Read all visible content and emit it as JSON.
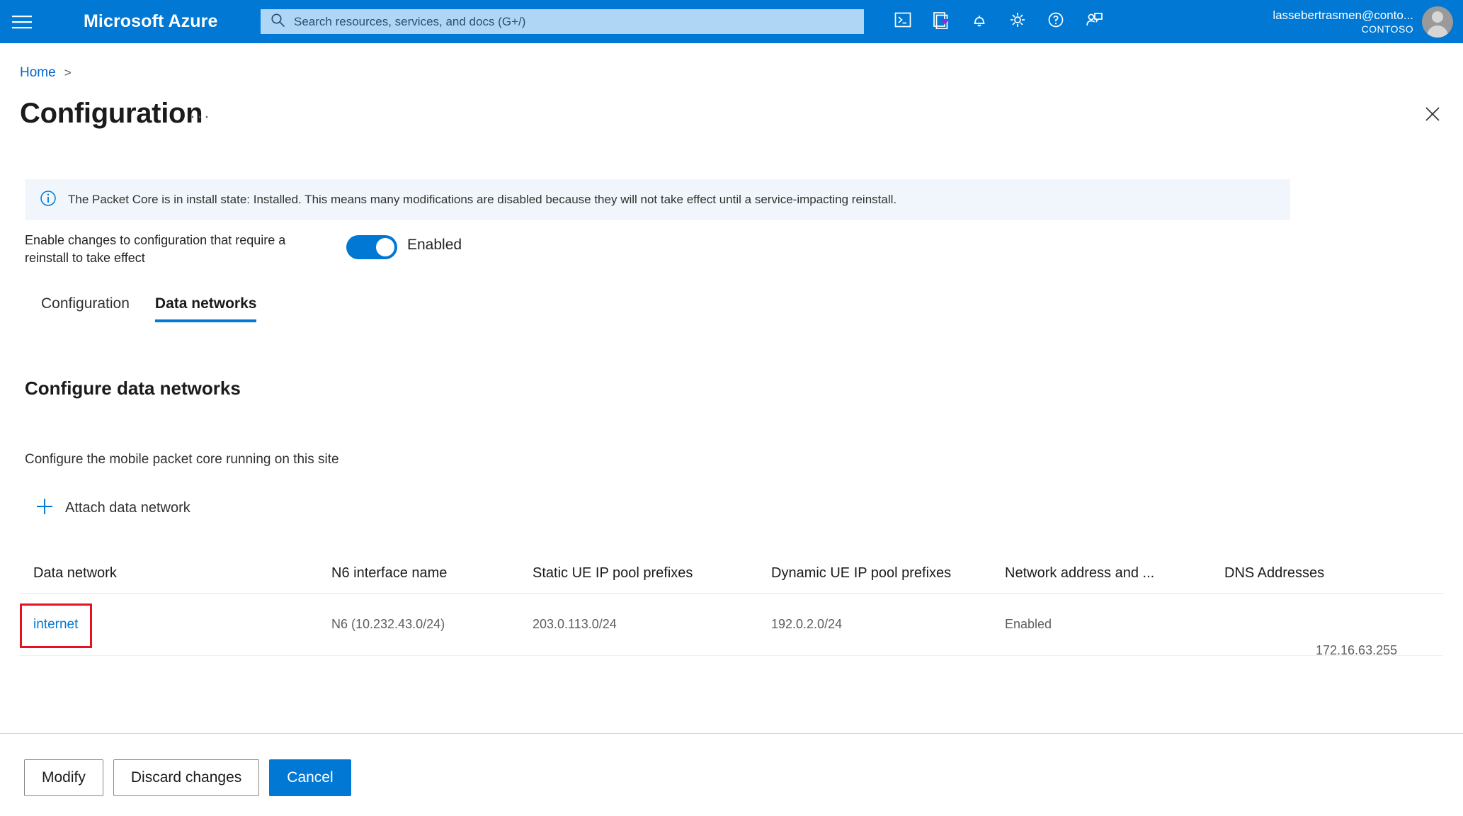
{
  "topbar": {
    "menu_icon": "hamburger-icon",
    "brand": "Microsoft Azure",
    "search": {
      "icon": "search-icon",
      "placeholder": "Search resources, services, and docs (G+/)",
      "value": ""
    },
    "icons": [
      {
        "name": "cloud-shell-icon",
        "title": "Cloud Shell"
      },
      {
        "name": "directories-subscriptions-icon",
        "title": "Directories + subscriptions"
      },
      {
        "name": "notifications-bell-icon",
        "title": "Notifications"
      },
      {
        "name": "settings-gear-icon",
        "title": "Settings"
      },
      {
        "name": "help-question-icon",
        "title": "Help"
      },
      {
        "name": "feedback-icon",
        "title": "Feedback"
      }
    ],
    "account": {
      "name": "lassebertrasmen@conto...",
      "org": "CONTOSO",
      "avatar": "user-avatar"
    }
  },
  "breadcrumb": {
    "home": "Home",
    "separator": ">"
  },
  "page": {
    "title": "Configuration",
    "ellipsis": "···",
    "close_icon": "close-icon"
  },
  "banner": {
    "icon": "info-icon",
    "text": "The Packet Core is in install state: Installed. This means many modifications are disabled because they will not take effect until a service-impacting reinstall."
  },
  "reinstall_toggle": {
    "label": "Enable changes to configuration that require a reinstall to take effect",
    "state": "Enabled",
    "on": true
  },
  "tabs": [
    {
      "label": "Configuration",
      "active": false
    },
    {
      "label": "Data networks",
      "active": true
    }
  ],
  "section": {
    "title": "Configure data networks",
    "description": "Configure the mobile packet core running on this site",
    "attach_button": {
      "icon": "plus-icon",
      "label": "Attach data network"
    }
  },
  "table": {
    "columns": [
      "Data network",
      "N6 interface name",
      "Static UE IP pool prefixes",
      "Dynamic UE IP pool prefixes",
      "Network address and ...",
      "DNS Addresses"
    ],
    "rows": [
      {
        "data_network": "internet",
        "n6_interface_name": "N6 (10.232.43.0/24)",
        "static_ue_ip_pool_prefixes": "203.0.113.0/24",
        "dynamic_ue_ip_pool_prefixes": "192.0.2.0/24",
        "network_address_and_port_translation": "Enabled",
        "dns_addresses": "172.16.63.255",
        "highlighted": true
      }
    ]
  },
  "footer": {
    "modify": "Modify",
    "discard": "Discard changes",
    "cancel": "Cancel"
  },
  "colors": {
    "azure_blue": "#0078d4",
    "link_blue": "#0066cc",
    "banner_bg": "#f0f6fc",
    "highlight_red": "#e81123"
  }
}
